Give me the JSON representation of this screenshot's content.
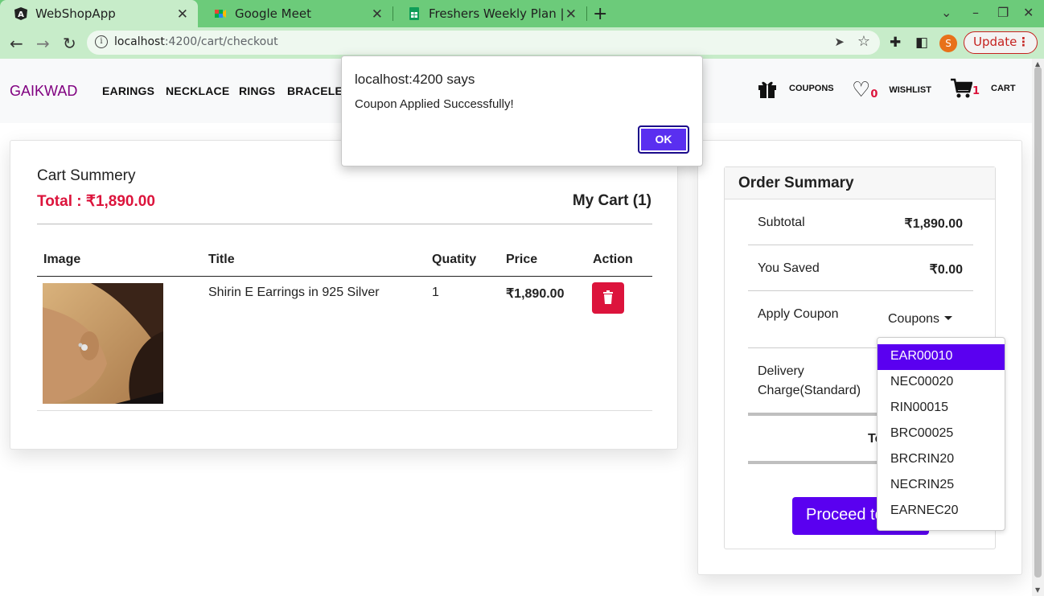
{
  "browser": {
    "tabs": [
      {
        "label": "WebShopApp",
        "icon": "angular-icon"
      },
      {
        "label": "Google Meet",
        "icon": "google-meet-icon"
      },
      {
        "label": "Freshers Weekly Plan | Sh",
        "icon": "google-sheets-icon"
      }
    ],
    "url_host": "localhost",
    "url_path": ":4200/cart/checkout",
    "profile_initial": "S",
    "update_label": "Update"
  },
  "navbar": {
    "brand": "GAIKWAD",
    "links": [
      "EARINGS",
      "NECKLACE",
      "RINGS",
      "BRACELET"
    ],
    "coupons_label": "COUPONS",
    "wishlist_label": "WISHLIST",
    "wishlist_count": "0",
    "cart_label": "CART",
    "cart_count": "1"
  },
  "cart": {
    "title": "Cart Summery",
    "total": "Total : ₹1,890.00",
    "my_cart": "My Cart (1)",
    "columns": [
      "Image",
      "Title",
      "Quatity",
      "Price",
      "Action"
    ],
    "item": {
      "title": "Shirin E Earrings in 925 Silver",
      "quantity": "1",
      "price": "₹1,890.00"
    }
  },
  "order_summary": {
    "title": "Order Summary",
    "subtotal_label": "Subtotal",
    "subtotal_value": "₹1,890.00",
    "saved_label": "You Saved",
    "saved_value": "₹0.00",
    "coupon_label": "Apply Coupon",
    "coupon_toggle": "Coupons",
    "delivery_label_1": "Delivery",
    "delivery_label_2": "Charge(Standard)",
    "total_label": "To",
    "proceed_label": "Proceed to Checkout"
  },
  "coupon_dropdown": {
    "items": [
      "EAR00010",
      "NEC00020",
      "RIN00015",
      "BRC00025",
      "BRCRIN20",
      "NECRIN25",
      "EARNEC20"
    ],
    "active_index": 0
  },
  "alert": {
    "title": "localhost:4200 says",
    "message": "Coupon Applied Successfully!",
    "ok_label": "OK"
  },
  "colors": {
    "brand": "#800080",
    "accent": "#5a00f0",
    "danger": "#dc143c",
    "chrome_green": "#6ccb7a"
  }
}
